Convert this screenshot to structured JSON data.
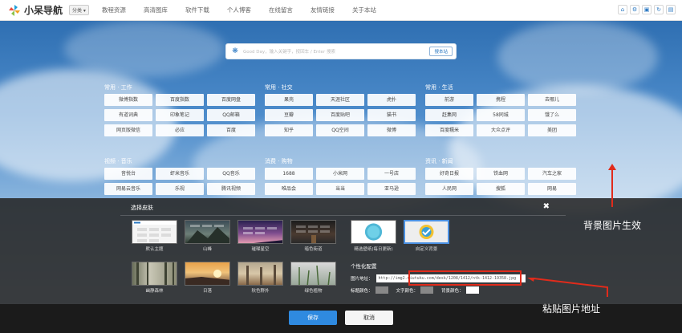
{
  "header": {
    "logo_text": "小呆导航",
    "category_button": "分类",
    "nav": [
      "教程资源",
      "高清图库",
      "软件下载",
      "个人博客",
      "在线留言",
      "友情链接",
      "关于本站"
    ],
    "tools": [
      "home-icon",
      "settings-icon",
      "image-icon",
      "refresh-icon",
      "save-icon"
    ]
  },
  "search": {
    "placeholder": "Good Day，输入关键字，按回车 / Enter 搜索",
    "button": "搜本站"
  },
  "sections": [
    {
      "title": "常用 · 工作",
      "items": [
        "微博指数",
        "百度指数",
        "百度网盘",
        "有道词典",
        "印象笔记",
        "QQ邮箱",
        "网页版微信",
        "必应",
        "百度"
      ]
    },
    {
      "title": "常用 · 社交",
      "items": [
        "果壳",
        "天涯社区",
        "虎扑",
        "豆瓣",
        "百度贴吧",
        "猫书",
        "知乎",
        "QQ空间",
        "微博"
      ]
    },
    {
      "title": "常用 · 生活",
      "items": [
        "前游",
        "携程",
        "去哪儿",
        "赶集网",
        "58同城",
        "饿了么",
        "百度糯米",
        "大众点评",
        "美团"
      ]
    },
    {
      "title": "视频 · 音乐",
      "items": [
        "音悦台",
        "虾米音乐",
        "QQ音乐",
        "网易云音乐",
        "乐视",
        "腾讯视频",
        "",
        "",
        ""
      ]
    },
    {
      "title": "消费 · 购物",
      "items": [
        "1688",
        "小米网",
        "一号店",
        "唯品会",
        "当当",
        "亚马逊",
        "",
        "",
        ""
      ]
    },
    {
      "title": "资讯 · 新闻",
      "items": [
        "好奇日报",
        "铁血网",
        "汽车之家",
        "人民网",
        "搜狐",
        "网易",
        "",
        "",
        ""
      ]
    }
  ],
  "modal": {
    "title": "选择皮肤",
    "close": "✖",
    "skins": [
      {
        "label": "默认主题"
      },
      {
        "label": "山峰"
      },
      {
        "label": "璀璨星空"
      },
      {
        "label": "暗色街道"
      },
      {
        "label": "精选壁纸(每日更新)"
      },
      {
        "label": "自定义背景"
      },
      {
        "label": "幽静森林"
      },
      {
        "label": "日落"
      },
      {
        "label": "秋色野外"
      },
      {
        "label": "绿色植物"
      }
    ],
    "custom_title": "个性化配置",
    "url_label": "图片地址：",
    "url_value": "http://img2.niutuku.com/desk/1208/1412/ntk-1412-19358.jpg",
    "color_labels": [
      "标题颜色：",
      "文字颜色：",
      "背景颜色："
    ],
    "colors": [
      "#888888",
      "#888888",
      "#ffffff"
    ],
    "save": "保存",
    "cancel": "取消"
  },
  "annotations": {
    "bg_effect": "背景图片生效",
    "paste_url": "粘贴图片地址"
  }
}
